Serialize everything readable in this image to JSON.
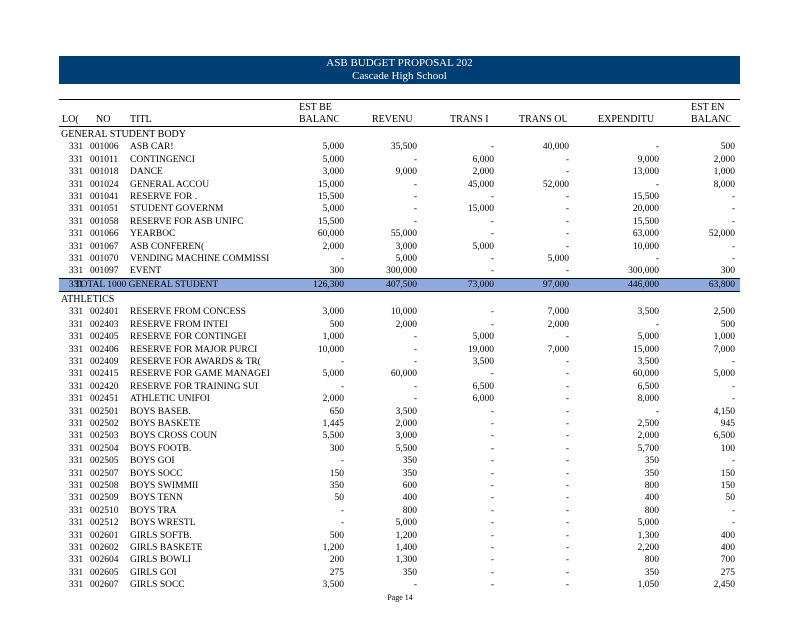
{
  "header": {
    "title": "ASB BUDGET PROPOSAL 202",
    "school": "Cascade High School"
  },
  "columns": {
    "loc": "LO(",
    "no": "NO",
    "title": "TITL",
    "est_begin": [
      "EST BE",
      "BALANC"
    ],
    "revenue": "REVENU",
    "trans_in": "TRANS I",
    "trans_out": "TRANS OU",
    "expenditures": "EXPENDITU",
    "est_end": [
      "EST EN",
      "BALANC"
    ]
  },
  "general": {
    "section": "GENERAL STUDENT BODY",
    "rows": [
      [
        "331",
        "001006",
        "ASB CAR!",
        "5,000",
        "35,500",
        "-",
        "40,000",
        "-",
        "500"
      ],
      [
        "331",
        "001011",
        "CONTINGENCI",
        "5,000",
        "-",
        "6,000",
        "-",
        "9,000",
        "2,000"
      ],
      [
        "331",
        "001018",
        "DANCE",
        "3,000",
        "9,000",
        "2,000",
        "-",
        "13,000",
        "1,000"
      ],
      [
        "331",
        "001024",
        "GENERAL ACCOU",
        "15,000",
        "-",
        "45,000",
        "52,000",
        "-",
        "8,000"
      ],
      [
        "331",
        "001041",
        "RESERVE FOR .",
        "15,500",
        "-",
        "-",
        "-",
        "15,500",
        "-"
      ],
      [
        "331",
        "001051",
        "STUDENT GOVERNM",
        "5,000",
        "-",
        "15,000",
        "-",
        "20,000",
        "-"
      ],
      [
        "331",
        "001058",
        "RESERVE FOR ASB UNIFC",
        "15,500",
        "-",
        "-",
        "-",
        "15,500",
        "-"
      ],
      [
        "331",
        "001066",
        "YEARBOC",
        "60,000",
        "55,000",
        "-",
        "-",
        "63,000",
        "52,000"
      ],
      [
        "331",
        "001067",
        "ASB CONFEREN(",
        "2,000",
        "3,000",
        "5,000",
        "-",
        "10,000",
        "-"
      ],
      [
        "331",
        "001070",
        "VENDING MACHINE COMMISSI",
        "-",
        "5,000",
        "-",
        "5,000",
        "-",
        "-"
      ],
      [
        "331",
        "001097",
        "EVENT",
        "300",
        "300,000",
        "-",
        "-",
        "300,000",
        "300"
      ]
    ],
    "total": [
      "331",
      "TOTAL 1000 GENERAL STUDENT",
      "126,300",
      "407,500",
      "73,000",
      "97,000",
      "446,000",
      "63,800"
    ]
  },
  "athletics": {
    "section": "ATHLETICS",
    "rows": [
      [
        "331",
        "002401",
        "RESERVE FROM CONCESS",
        "3,000",
        "10,000",
        "-",
        "7,000",
        "3,500",
        "2,500"
      ],
      [
        "331",
        "002403",
        "RESERVE FROM INTEI",
        "500",
        "2,000",
        "-",
        "2,000",
        "-",
        "500"
      ],
      [
        "331",
        "002405",
        "RESERVE FOR CONTINGEI",
        "1,000",
        "-",
        "5,000",
        "-",
        "5,000",
        "1,000"
      ],
      [
        "331",
        "002406",
        "RESERVE FOR MAJOR PURCI",
        "10,000",
        "-",
        "19,000",
        "7,000",
        "15,000",
        "7,000"
      ],
      [
        "331",
        "002409",
        "RESERVE FOR AWARDS & TR(",
        "-",
        "-",
        "3,500",
        "-",
        "3,500",
        "-"
      ],
      [
        "331",
        "002415",
        "RESERVE FOR GAME MANAGEI",
        "5,000",
        "60,000",
        "-",
        "-",
        "60,000",
        "5,000"
      ],
      [
        "331",
        "002420",
        "RESERVE FOR TRAINING SUI",
        "-",
        "-",
        "6,500",
        "-",
        "6,500",
        "-"
      ],
      [
        "331",
        "002451",
        "ATHLETIC UNIFOI",
        "2,000",
        "-",
        "6,000",
        "-",
        "8,000",
        "-"
      ],
      [
        "331",
        "002501",
        "BOYS BASEB.",
        "650",
        "3,500",
        "-",
        "-",
        "-",
        "4,150"
      ],
      [
        "331",
        "002502",
        "BOYS BASKETE",
        "1,445",
        "2,000",
        "-",
        "-",
        "2,500",
        "945"
      ],
      [
        "331",
        "002503",
        "BOYS CROSS COUN",
        "5,500",
        "3,000",
        "-",
        "-",
        "2,000",
        "6,500"
      ],
      [
        "331",
        "002504",
        "BOYS FOOTB.",
        "300",
        "5,500",
        "-",
        "-",
        "5,700",
        "100"
      ],
      [
        "331",
        "002505",
        "BOYS GOI",
        "-",
        "350",
        "-",
        "-",
        "350",
        "-"
      ],
      [
        "331",
        "002507",
        "BOYS SOCC",
        "150",
        "350",
        "-",
        "-",
        "350",
        "150"
      ],
      [
        "331",
        "002508",
        "BOYS SWIMMII",
        "350",
        "600",
        "-",
        "-",
        "800",
        "150"
      ],
      [
        "331",
        "002509",
        "BOYS TENN",
        "50",
        "400",
        "-",
        "-",
        "400",
        "50"
      ],
      [
        "331",
        "002510",
        "BOYS TRA",
        "-",
        "800",
        "-",
        "-",
        "800",
        "-"
      ],
      [
        "331",
        "002512",
        "BOYS WRESTL",
        "-",
        "5,000",
        "-",
        "-",
        "5,000",
        "-"
      ],
      [
        "331",
        "002601",
        "GIRLS SOFTB.",
        "500",
        "1,200",
        "-",
        "-",
        "1,300",
        "400"
      ],
      [
        "331",
        "002602",
        "GIRLS BASKETE",
        "1,200",
        "1,400",
        "-",
        "-",
        "2,200",
        "400"
      ],
      [
        "331",
        "002604",
        "GIRLS BOWLI",
        "200",
        "1,300",
        "-",
        "-",
        "800",
        "700"
      ],
      [
        "331",
        "002605",
        "GIRLS GOI",
        "275",
        "350",
        "-",
        "-",
        "350",
        "275"
      ],
      [
        "331",
        "002607",
        "GIRLS SOCC",
        "3,500",
        "-",
        "-",
        "-",
        "1,050",
        "2,450"
      ]
    ]
  },
  "footer": {
    "page": "Page 14"
  },
  "colors": {
    "banner": "#003f73",
    "total_row": "#8eaadb"
  }
}
